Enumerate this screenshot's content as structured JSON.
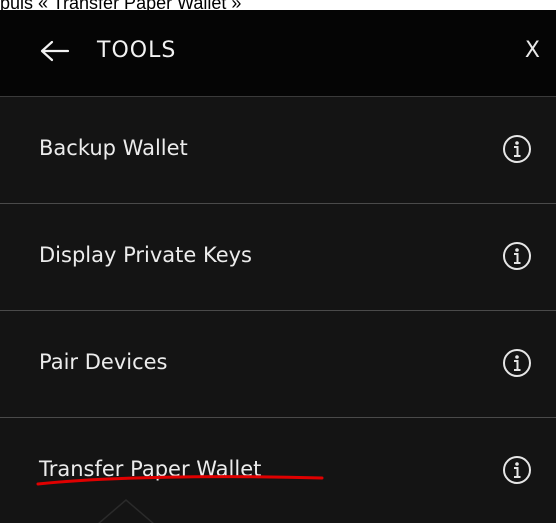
{
  "caption": {
    "text": "puis « Transfer Paper Wallet »"
  },
  "header": {
    "back_icon": "arrow-left-icon",
    "title": "TOOLS",
    "close_label": "X"
  },
  "menu": {
    "items": [
      {
        "label": "Backup Wallet",
        "icon": "info-circle-icon"
      },
      {
        "label": "Display Private Keys",
        "icon": "info-circle-icon"
      },
      {
        "label": "Pair Devices",
        "icon": "info-circle-icon"
      },
      {
        "label": "Transfer Paper Wallet",
        "icon": "info-circle-icon"
      }
    ]
  },
  "annotation": {
    "underline_color": "#e00000"
  },
  "colors": {
    "panel_background": "#141414",
    "header_background": "#050505",
    "divider": "#4a4a4a",
    "text": "#ececec"
  }
}
